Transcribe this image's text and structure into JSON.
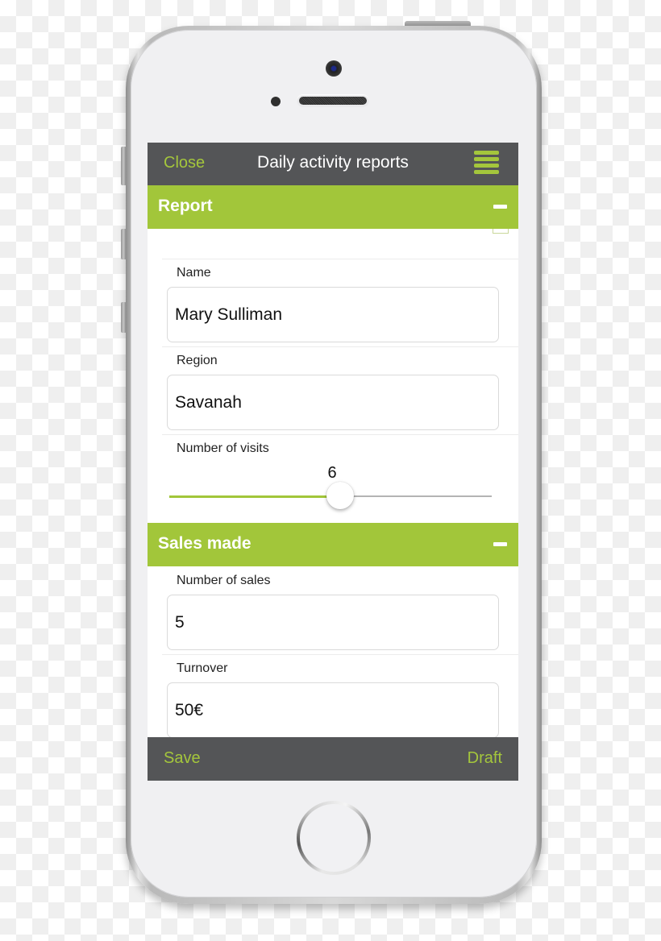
{
  "app": {
    "title": "Daily activity reports",
    "close_label": "Close",
    "menu_icon": "hamburger-menu-icon"
  },
  "colors": {
    "header_dark": "#545557",
    "accent_green": "#a2c63a",
    "accent_text": "#a4c63c"
  },
  "sections": {
    "report": {
      "label": "Report",
      "collapse_icon": "minus-icon",
      "fields": {
        "name": {
          "label": "Name",
          "value": "Mary Sulliman"
        },
        "region": {
          "label": "Region",
          "value": "Savanah"
        },
        "visits": {
          "label": "Number of visits",
          "value": "6",
          "fill_fraction": 0.53
        }
      }
    },
    "sales": {
      "label": "Sales made",
      "collapse_icon": "minus-icon",
      "fields": {
        "sales_count": {
          "label": "Number of sales",
          "value": "5"
        },
        "turnover": {
          "label": "Turnover",
          "value": "50€"
        }
      }
    }
  },
  "footer": {
    "save_label": "Save",
    "draft_label": "Draft"
  }
}
